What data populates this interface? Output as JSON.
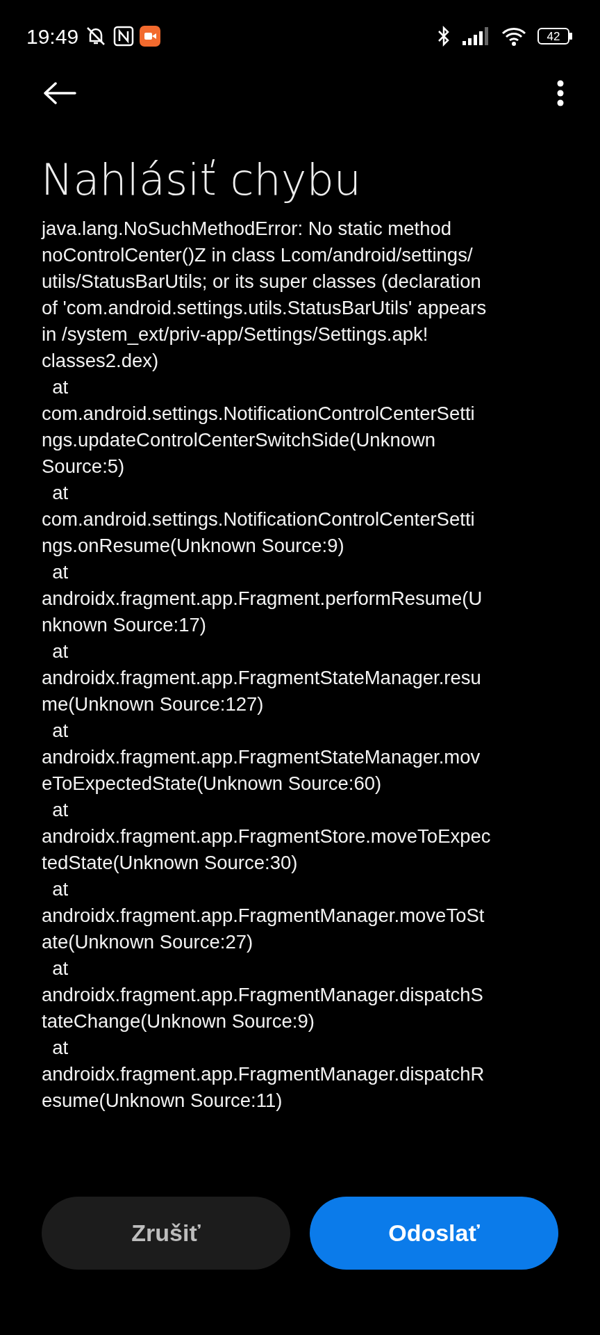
{
  "status_bar": {
    "time": "19:49",
    "battery": "42"
  },
  "title": "Nahlásiť chybu",
  "error_lines": [
    "java.lang.NoSuchMethodError: No static method",
    "noControlCenter()Z in class Lcom/android/settings/",
    "utils/StatusBarUtils; or its super classes (declaration",
    "of 'com.android.settings.utils.StatusBarUtils' appears",
    "in /system_ext/priv-app/Settings/Settings.apk!",
    "classes2.dex)",
    "  at",
    "com.android.settings.NotificationControlCenterSetti",
    "ngs.updateControlCenterSwitchSide(Unknown",
    "Source:5)",
    "  at",
    "com.android.settings.NotificationControlCenterSetti",
    "ngs.onResume(Unknown Source:9)",
    "  at",
    "androidx.fragment.app.Fragment.performResume(U",
    "nknown Source:17)",
    "  at",
    "androidx.fragment.app.FragmentStateManager.resu",
    "me(Unknown Source:127)",
    "  at",
    "androidx.fragment.app.FragmentStateManager.mov",
    "eToExpectedState(Unknown Source:60)",
    "  at",
    "androidx.fragment.app.FragmentStore.moveToExpec",
    "tedState(Unknown Source:30)",
    "  at",
    "androidx.fragment.app.FragmentManager.moveToSt",
    "ate(Unknown Source:27)",
    "  at",
    "androidx.fragment.app.FragmentManager.dispatchS",
    "tateChange(Unknown Source:9)",
    "  at",
    "androidx.fragment.app.FragmentManager.dispatchR",
    "esume(Unknown Source:11)"
  ],
  "buttons": [
    {
      "label": "Zrušiť",
      "kind": "secondary"
    },
    {
      "label": "Odoslať",
      "kind": "primary"
    }
  ]
}
